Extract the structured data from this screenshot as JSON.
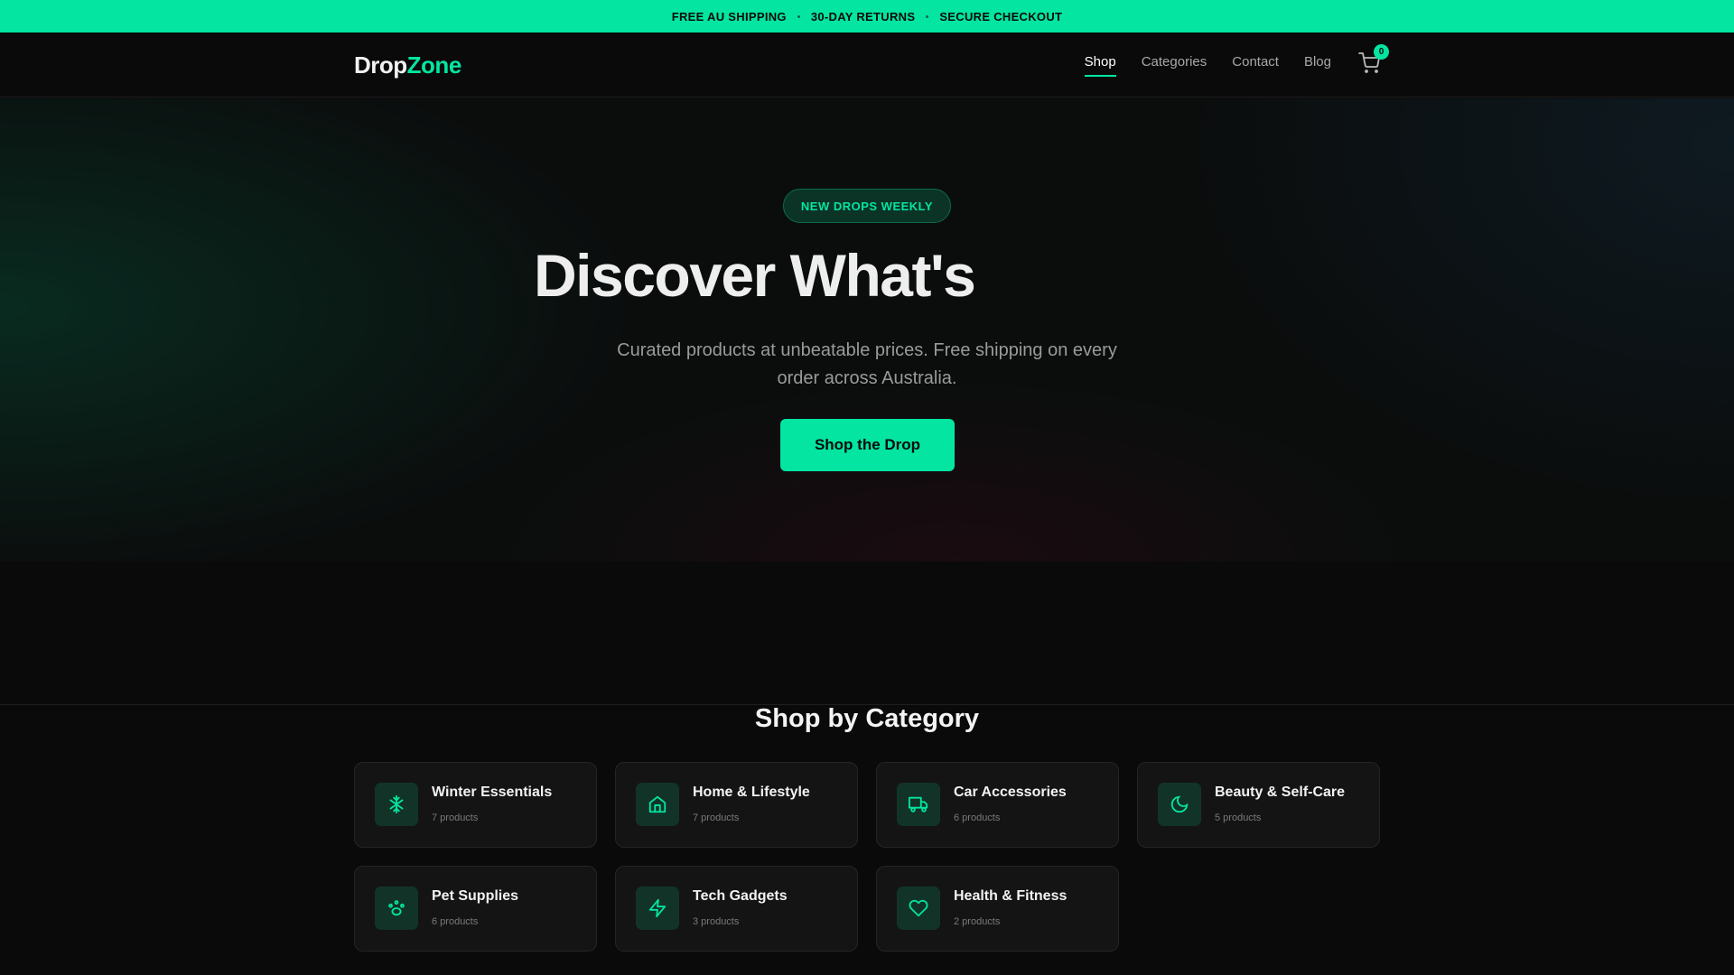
{
  "announcement": [
    "FREE AU SHIPPING",
    "30-DAY RETURNS",
    "SECURE CHECKOUT"
  ],
  "logo": {
    "part1": "Drop",
    "part2": "Zone"
  },
  "nav": {
    "links": [
      "Shop",
      "Categories",
      "Contact",
      "Blog"
    ],
    "active": "Shop",
    "cart_count": "0"
  },
  "hero": {
    "badge": "NEW DROPS WEEKLY",
    "title": "Discover What's",
    "subtitle": "Curated products at unbeatable prices. Free shipping on every order across Australia.",
    "cta": "Shop the Drop"
  },
  "categories": {
    "title": "Shop by Category",
    "items": [
      {
        "name": "Winter Essentials",
        "count": "7 products",
        "icon": "snowflake-icon"
      },
      {
        "name": "Home & Lifestyle",
        "count": "7 products",
        "icon": "home-icon"
      },
      {
        "name": "Car Accessories",
        "count": "6 products",
        "icon": "truck-icon"
      },
      {
        "name": "Beauty & Self-Care",
        "count": "5 products",
        "icon": "moon-icon"
      },
      {
        "name": "Pet Supplies",
        "count": "6 products",
        "icon": "paw-icon"
      },
      {
        "name": "Tech Gadgets",
        "count": "3 products",
        "icon": "lightning-icon"
      },
      {
        "name": "Health & Fitness",
        "count": "2 products",
        "icon": "heart-icon"
      }
    ]
  },
  "colors": {
    "accent": "#03e5a0",
    "background": "#0a0a0a"
  }
}
